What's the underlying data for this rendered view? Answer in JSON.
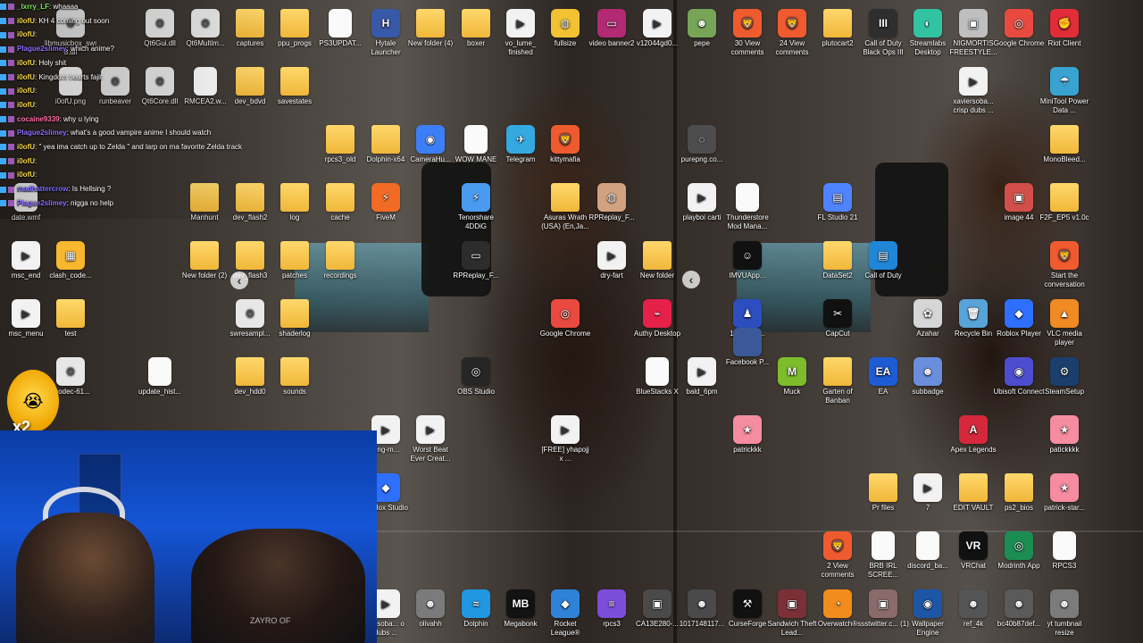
{
  "chat": {
    "lines": [
      {
        "user": "_lxrry_LF",
        "message": ": whaaaa",
        "color": "#7ce85a"
      },
      {
        "user": "i0ofU",
        "message": ": KH 4 coming out soon",
        "color": "#f7d442"
      },
      {
        "user": "i0ofU",
        "message": ": ",
        "color": "#f7d442"
      },
      {
        "user": "Plague2slimey",
        "message": ": which anime?",
        "color": "#8f6cff"
      },
      {
        "user": "i0ofU",
        "message": ": Holy shit",
        "color": "#f7d442"
      },
      {
        "user": "i0ofU",
        "message": ": Kingdom hearts fajit",
        "color": "#f7d442"
      },
      {
        "user": "i0ofU",
        "message": ": ",
        "color": "#f7d442"
      },
      {
        "user": "i0ofU",
        "message": ": ",
        "color": "#f7d442"
      },
      {
        "user": "cocaine9339",
        "message": ": why u lying",
        "color": "#ff6ea8"
      },
      {
        "user": "Plague2slimey",
        "message": ": what's a good vampire anime I should watch",
        "color": "#8f6cff"
      },
      {
        "user": "i0ofU",
        "message": ": \" yea ima catch up to Zelda \" and larp on ma favorite Zelda track",
        "color": "#f7d442"
      },
      {
        "user": "i0ofU",
        "message": ": ",
        "color": "#f7d442"
      },
      {
        "user": "i0ofU",
        "message": ": ",
        "color": "#f7d442"
      },
      {
        "user": "madhattercrow",
        "message": ": Is Hellsing ?",
        "color": "#7c6cff"
      },
      {
        "user": "Plague2slimey",
        "message": ": nigga no help",
        "color": "#8f6cff"
      }
    ]
  },
  "overlay": {
    "emote_text": "x2",
    "desk_text": "ZAYRO OF"
  },
  "desktop": {
    "arrows": {
      "left": "‹",
      "right": "‹"
    },
    "icons": [
      {
        "label": "libmusicbox_swscale-8.dll",
        "type": "gear",
        "glyph": "⚙"
      },
      {
        "label": "Qt6Gui.dll",
        "type": "gear",
        "glyph": "⚙"
      },
      {
        "label": "Qt6Multim...",
        "type": "gear",
        "glyph": "⚙"
      },
      {
        "label": "captures",
        "type": "folder",
        "glyph": ""
      },
      {
        "label": "ppu_progs",
        "type": "folder",
        "glyph": ""
      },
      {
        "label": "PS3UPDAT...",
        "type": "file",
        "glyph": ""
      },
      {
        "label": "Hytale Launcher",
        "type": "app",
        "glyph": "H",
        "color": "#3859a8"
      },
      {
        "label": "New folder (4)",
        "type": "folder",
        "glyph": ""
      },
      {
        "label": "boxer",
        "type": "folder",
        "glyph": ""
      },
      {
        "label": "vo_lume_ finished",
        "type": "video",
        "glyph": "▶"
      },
      {
        "label": "fullsize",
        "type": "app",
        "glyph": "◍",
        "color": "#f2c233"
      },
      {
        "label": "video banner2",
        "type": "app",
        "glyph": "▭",
        "color": "#b22a73"
      },
      {
        "label": "v12044gd0...",
        "type": "video",
        "glyph": "▶"
      },
      {
        "label": "pepe",
        "type": "app",
        "glyph": "☻",
        "color": "#77a456"
      },
      {
        "label": "30 View comments",
        "type": "app",
        "glyph": "🦁",
        "color": "#ef5b2f"
      },
      {
        "label": "24 View comments",
        "type": "app",
        "glyph": "🦁",
        "color": "#ef5b2f"
      },
      {
        "label": "plutocart2",
        "type": "folder",
        "glyph": ""
      },
      {
        "label": "Call of Duty Black Ops III",
        "type": "app",
        "glyph": "III",
        "color": "#2e2e2e"
      },
      {
        "label": "Streamlabs Desktop",
        "type": "app",
        "glyph": "◐",
        "color": "#31c3a2"
      },
      {
        "label": "NIGMORTIS FREESTYLE...",
        "type": "app",
        "glyph": "▣",
        "color": "#bfbfbf"
      },
      {
        "label": "Google Chrome",
        "type": "app",
        "glyph": "◎",
        "color": "#e94a3f"
      },
      {
        "label": "Riot Client",
        "type": "app",
        "glyph": "✊",
        "color": "#e12d39"
      },
      {
        "label": "i0ofU.png",
        "type": "file",
        "glyph": ""
      },
      {
        "label": "runbeaver",
        "type": "gear",
        "glyph": "⚙"
      },
      {
        "label": "Qt6Core.dll",
        "type": "gear",
        "glyph": "⚙"
      },
      {
        "label": "RMCEA2.w...",
        "type": "file",
        "glyph": ""
      },
      {
        "label": "dev_bdvd",
        "type": "folder",
        "glyph": ""
      },
      {
        "label": "savestates",
        "type": "folder",
        "glyph": ""
      },
      {
        "label": "xaviersoba... crisp dubs ...",
        "type": "video",
        "glyph": "▶"
      },
      {
        "label": "MiniTool Power Data ...",
        "type": "app",
        "glyph": "☂",
        "color": "#38a3d1"
      },
      {
        "label": "rpcs3_old",
        "type": "folder",
        "glyph": ""
      },
      {
        "label": "Dolphin-x64",
        "type": "folder",
        "glyph": ""
      },
      {
        "label": "CameraHu...",
        "type": "app",
        "glyph": "◉",
        "color": "#3c7ef7"
      },
      {
        "label": "WOW MANE",
        "type": "file",
        "glyph": ""
      },
      {
        "label": "Telegram",
        "type": "app",
        "glyph": "✈",
        "color": "#35a9e1"
      },
      {
        "label": "kittymafia",
        "type": "app",
        "glyph": "🦁",
        "color": "#ef5b2f"
      },
      {
        "label": "purepng.co...",
        "type": "app",
        "glyph": "◌",
        "color": "#4d4d4d"
      },
      {
        "label": "MonoBleed...",
        "type": "folder",
        "glyph": ""
      },
      {
        "label": "date.wmf",
        "type": "file",
        "glyph": ""
      },
      {
        "label": "Manhunt",
        "type": "folder",
        "glyph": ""
      },
      {
        "label": "dev_flash2",
        "type": "folder",
        "glyph": ""
      },
      {
        "label": "log",
        "type": "folder",
        "glyph": ""
      },
      {
        "label": "cache",
        "type": "folder",
        "glyph": ""
      },
      {
        "label": "FiveM",
        "type": "app",
        "glyph": "⚡",
        "color": "#f16b24"
      },
      {
        "label": "Tenorshare 4DDiG",
        "type": "app",
        "glyph": "⚡",
        "color": "#4a9bf0"
      },
      {
        "label": "Asuras Wrath (USA) (En,Ja...",
        "type": "folder",
        "glyph": ""
      },
      {
        "label": "RPReplay_F...",
        "type": "app",
        "glyph": "◍",
        "color": "#d1a27f"
      },
      {
        "label": "playboi carti",
        "type": "video",
        "glyph": "▶"
      },
      {
        "label": "Thunderstore Mod Mana...",
        "type": "file",
        "glyph": ""
      },
      {
        "label": "FL Studio 21",
        "type": "app",
        "glyph": "▤",
        "color": "#4e84ff"
      },
      {
        "label": "image 44",
        "type": "app",
        "glyph": "▣",
        "color": "#d24f49"
      },
      {
        "label": "F2F_EP5 v1.0c",
        "type": "folder",
        "glyph": ""
      },
      {
        "label": "msc_end",
        "type": "video",
        "glyph": "▶"
      },
      {
        "label": "clash_code...",
        "type": "app",
        "glyph": "▦",
        "color": "#f7b72f"
      },
      {
        "label": "New folder (2)",
        "type": "folder",
        "glyph": ""
      },
      {
        "label": "dev_flash3",
        "type": "folder",
        "glyph": ""
      },
      {
        "label": "patches",
        "type": "folder",
        "glyph": ""
      },
      {
        "label": "recordings",
        "type": "folder",
        "glyph": ""
      },
      {
        "label": "RPReplay_F...",
        "type": "app",
        "glyph": "▭",
        "color": "#2c2c2c"
      },
      {
        "label": "dry-fart",
        "type": "video",
        "glyph": "▶"
      },
      {
        "label": "New folder",
        "type": "folder",
        "glyph": ""
      },
      {
        "label": "IMVUApp...",
        "type": "app",
        "glyph": "☺",
        "color": "#111111"
      },
      {
        "label": "DataSet2",
        "type": "folder",
        "glyph": ""
      },
      {
        "label": "Call of Duty",
        "type": "app",
        "glyph": "▤",
        "color": "#1f86d8"
      },
      {
        "label": "Start the conversation",
        "type": "app",
        "glyph": "🦁",
        "color": "#ef5b2f"
      },
      {
        "label": "msc_menu",
        "type": "video",
        "glyph": "▶"
      },
      {
        "label": "test",
        "type": "folder",
        "glyph": ""
      },
      {
        "label": "swresampl...",
        "type": "gear",
        "glyph": "⚙"
      },
      {
        "label": "shaderlog",
        "type": "folder",
        "glyph": ""
      },
      {
        "label": "Google Chrome",
        "type": "app",
        "glyph": "◎",
        "color": "#e94a3f"
      },
      {
        "label": "Authy Desktop",
        "type": "app",
        "glyph": "⌁",
        "color": "#e52149"
      },
      {
        "label": "1080FCe...",
        "type": "app",
        "glyph": "♟",
        "color": "#2c4ebf"
      },
      {
        "label": "Facebook P...",
        "type": "app",
        "glyph": "",
        "color": "#3b5998"
      },
      {
        "label": "CapCut",
        "type": "app",
        "glyph": "✂",
        "color": "#111111"
      },
      {
        "label": "Azahar",
        "type": "app",
        "glyph": "✿",
        "color": "#d6d6d6"
      },
      {
        "label": "Recycle Bin",
        "type": "app",
        "glyph": "🗑",
        "color": "#58a4d8"
      },
      {
        "label": "Roblox Player",
        "type": "app",
        "glyph": "◆",
        "color": "#2f6fff"
      },
      {
        "label": "VLC media player",
        "type": "app",
        "glyph": "▲",
        "color": "#f08a22"
      },
      {
        "label": "vcodec-61...",
        "type": "gear",
        "glyph": "⚙"
      },
      {
        "label": "update_hist...",
        "type": "file",
        "glyph": ""
      },
      {
        "label": "dev_hdd0",
        "type": "folder",
        "glyph": ""
      },
      {
        "label": "sounds",
        "type": "folder",
        "glyph": ""
      },
      {
        "label": "OBS Studio",
        "type": "app",
        "glyph": "◎",
        "color": "#262626"
      },
      {
        "label": "BlueStacks X",
        "type": "file",
        "glyph": ""
      },
      {
        "label": "bald_6pm",
        "type": "video",
        "glyph": "▶"
      },
      {
        "label": "Muck",
        "type": "app",
        "glyph": "M",
        "color": "#7dbd2c"
      },
      {
        "label": "Garten of Banban",
        "type": "folder",
        "glyph": ""
      },
      {
        "label": "EA",
        "type": "app",
        "glyph": "EA",
        "color": "#1e5cd5"
      },
      {
        "label": "subbadge",
        "type": "app",
        "glyph": "☻",
        "color": "#6a8edc"
      },
      {
        "label": "Ubisoft Connect",
        "type": "app",
        "glyph": "◉",
        "color": "#4d4dcf"
      },
      {
        "label": "SteamSetup",
        "type": "app",
        "glyph": "⚙",
        "color": "#1a3f6d"
      },
      {
        "label": "king-m...",
        "type": "video",
        "glyph": "▶"
      },
      {
        "label": "Worst Beat Ever Creat...",
        "type": "video",
        "glyph": "▶"
      },
      {
        "label": "[FREE] yhapojj x ...",
        "type": "video",
        "glyph": "▶"
      },
      {
        "label": "patrickkk",
        "type": "app",
        "glyph": "★",
        "color": "#f58ca0"
      },
      {
        "label": "Apex Legends",
        "type": "app",
        "glyph": "A",
        "color": "#d5283b"
      },
      {
        "label": "patickkkk",
        "type": "app",
        "glyph": "★",
        "color": "#f58ca0"
      },
      {
        "label": "Roblox Studio",
        "type": "app",
        "glyph": "◆",
        "color": "#2f6fff"
      },
      {
        "label": "Pr files",
        "type": "folder",
        "glyph": ""
      },
      {
        "label": "7",
        "type": "video",
        "glyph": "▶"
      },
      {
        "label": "EDIT VAULT",
        "type": "folder",
        "glyph": ""
      },
      {
        "label": "ps2_bios",
        "type": "folder",
        "glyph": ""
      },
      {
        "label": "patrick-star...",
        "type": "app",
        "glyph": "★",
        "color": "#f58ca0"
      },
      {
        "label": "2 View comments",
        "type": "app",
        "glyph": "🦁",
        "color": "#ef5b2f"
      },
      {
        "label": "BRB IRL SCREE...",
        "type": "file",
        "glyph": ""
      },
      {
        "label": "discord_ba...",
        "type": "file",
        "glyph": ""
      },
      {
        "label": "VRChat",
        "type": "app",
        "glyph": "VR",
        "color": "#111111"
      },
      {
        "label": "Modrinth App",
        "type": "app",
        "glyph": "◎",
        "color": "#1c8d52"
      },
      {
        "label": "RPCS3",
        "type": "file",
        "glyph": ""
      },
      {
        "label": "xersoba... o dubs ...",
        "type": "video",
        "glyph": "▶"
      },
      {
        "label": "olivahh",
        "type": "app",
        "glyph": "☻",
        "color": "#7b7b7b"
      },
      {
        "label": "Dolphin",
        "type": "app",
        "glyph": "≈",
        "color": "#2097e0"
      },
      {
        "label": "Megabonk",
        "type": "app",
        "glyph": "MB",
        "color": "#121212"
      },
      {
        "label": "Rocket League®",
        "type": "app",
        "glyph": "◆",
        "color": "#2e83d8"
      },
      {
        "label": "rpcs3",
        "type": "app",
        "glyph": "≡",
        "color": "#7c4dd9"
      },
      {
        "label": "CA13E280-...",
        "type": "app",
        "glyph": "▣",
        "color": "#4a4a4a"
      },
      {
        "label": "1017148117...",
        "type": "app",
        "glyph": "☻",
        "color": "#4a4a4a"
      },
      {
        "label": "CurseForge",
        "type": "app",
        "glyph": "⚒",
        "color": "#111111"
      },
      {
        "label": "Sandwich Theft Lead...",
        "type": "app",
        "glyph": "▣",
        "color": "#7b2f36"
      },
      {
        "label": "Overwatch®",
        "type": "app",
        "glyph": "◔",
        "color": "#f28c1c"
      },
      {
        "label": "ssstwitter.c... (1)",
        "type": "app",
        "glyph": "▣",
        "color": "#8a6a6a"
      },
      {
        "label": "Wallpaper Engine",
        "type": "app",
        "glyph": "◉",
        "color": "#1e56a6"
      },
      {
        "label": "ref_4k",
        "type": "app",
        "glyph": "☻",
        "color": "#555555"
      },
      {
        "label": "bc40b87def...",
        "type": "app",
        "glyph": "☻",
        "color": "#5a5a5a"
      },
      {
        "label": "yt tumbnail resize",
        "type": "app",
        "glyph": "☻",
        "color": "#7b7b7b"
      }
    ]
  }
}
